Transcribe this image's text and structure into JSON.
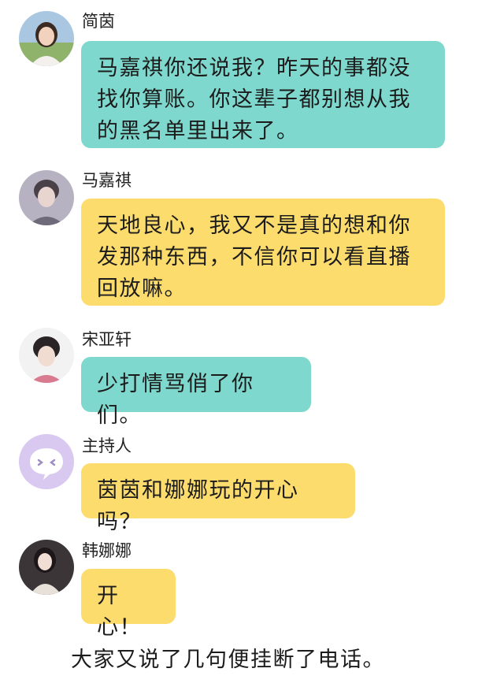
{
  "messages": [
    {
      "name": "简茵",
      "text": "马嘉祺你还说我？昨天的事都没找你算账。你这辈子都别想从我的黑名单里出来了。",
      "bubble_color": "#7fd8cd",
      "avatar": "girl-photo-avatar"
    },
    {
      "name": "马嘉祺",
      "text": "天地良心，我又不是真的想和你发那种东西，不信你可以看直播回放嘛。",
      "bubble_color": "#fddc6e",
      "avatar": "boy-photo-avatar"
    },
    {
      "name": "宋亚轩",
      "text": "少打情骂俏了你们。",
      "bubble_color": "#7fd8cd",
      "avatar": "boy-photo-avatar"
    },
    {
      "name": "主持人",
      "text": "茵茵和娜娜玩的开心吗？",
      "bubble_color": "#fddc6e",
      "avatar": "chat-bubble-icon"
    },
    {
      "name": "韩娜娜",
      "text": "开心！",
      "bubble_color": "#fddc6e",
      "avatar": "girl-photo-avatar"
    }
  ],
  "footer": "大家又说了几句便挂断了电话。"
}
